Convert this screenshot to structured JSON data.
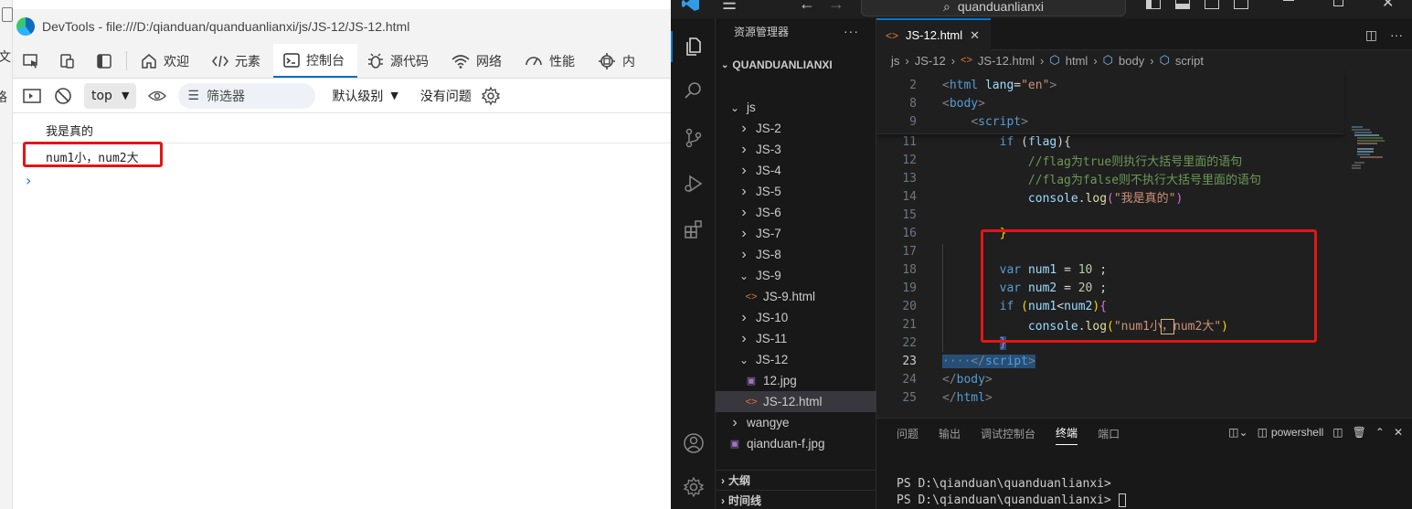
{
  "devtools": {
    "title": "DevTools - file:///D:/qianduan/quanduanlianxi/js/JS-12/JS-12.html",
    "tabs": [
      {
        "label": "欢迎",
        "icon": "home-icon"
      },
      {
        "label": "元素",
        "icon": "code-tag-icon"
      },
      {
        "label": "控制台",
        "icon": "console-icon"
      },
      {
        "label": "源代码",
        "icon": "bug-icon"
      },
      {
        "label": "网络",
        "icon": "wifi-icon"
      },
      {
        "label": "性能",
        "icon": "gauge-icon"
      },
      {
        "label": "内",
        "icon": "gear-chip-icon"
      }
    ],
    "active_tab": "控制台",
    "console_toolbar": {
      "context": "top",
      "filter_placeholder": "筛选器",
      "levels": "默认级别",
      "issues": "没有问题"
    },
    "console_lines": [
      "我是真的",
      "num1小，num2大"
    ],
    "edge_left_chars": [
      "文",
      "格"
    ],
    "accent_color": "#0f6cbd",
    "highlight_color": "#e51414"
  },
  "vscode": {
    "search": "quanduanlianxi",
    "explorer_title": "资源管理器",
    "workspace": "QUANDUANLIANXI",
    "tree": [
      {
        "label": "js",
        "type": "folder",
        "expanded": true,
        "depth": 1
      },
      {
        "label": "JS-2",
        "type": "folder",
        "expanded": false,
        "depth": 2
      },
      {
        "label": "JS-3",
        "type": "folder",
        "expanded": false,
        "depth": 2
      },
      {
        "label": "JS-4",
        "type": "folder",
        "expanded": false,
        "depth": 2
      },
      {
        "label": "JS-5",
        "type": "folder",
        "expanded": false,
        "depth": 2
      },
      {
        "label": "JS-6",
        "type": "folder",
        "expanded": false,
        "depth": 2
      },
      {
        "label": "JS-7",
        "type": "folder",
        "expanded": false,
        "depth": 2
      },
      {
        "label": "JS-8",
        "type": "folder",
        "expanded": false,
        "depth": 2
      },
      {
        "label": "JS-9",
        "type": "folder",
        "expanded": true,
        "depth": 2
      },
      {
        "label": "JS-9.html",
        "type": "html",
        "depth": 3
      },
      {
        "label": "JS-10",
        "type": "folder",
        "expanded": false,
        "depth": 2
      },
      {
        "label": "JS-11",
        "type": "folder",
        "expanded": false,
        "depth": 2
      },
      {
        "label": "JS-12",
        "type": "folder",
        "expanded": true,
        "depth": 2
      },
      {
        "label": "12.jpg",
        "type": "image",
        "depth": 3
      },
      {
        "label": "JS-12.html",
        "type": "html",
        "depth": 3,
        "selected": true
      },
      {
        "label": "wangye",
        "type": "folder",
        "expanded": false,
        "depth": 1
      },
      {
        "label": "qianduan-f.jpg",
        "type": "image",
        "depth": 1
      }
    ],
    "outline_label": "大纲",
    "timeline_label": "时间线",
    "editor_tab": "JS-12.html",
    "breadcrumb": [
      "js",
      "JS-12",
      "JS-12.html",
      "html",
      "body",
      "script"
    ],
    "sticky_lines": [
      {
        "n": "2",
        "html": "<span class='tg'>&lt;</span><span class='tn'>html</span> <span class='at'>lang</span><span class='pl'>=</span><span class='st'>\"en\"</span><span class='tg'>&gt;</span>"
      },
      {
        "n": "8",
        "html": "<span class='tg'>&lt;</span><span class='tn'>body</span><span class='tg'>&gt;</span>"
      },
      {
        "n": "9",
        "html": "    <span class='tg'>&lt;</span><span class='tn'>script</span><span class='tg'>&gt;</span>"
      }
    ],
    "code_lines": [
      {
        "n": "11",
        "html": "        <span class='kw'>if</span> <span class='pl'>(</span><span class='vr'>flag</span><span class='pl'>){</span>"
      },
      {
        "n": "12",
        "html": "            <span class='cm'>//flag为true则执行大括号里面的语句</span>"
      },
      {
        "n": "13",
        "html": "            <span class='cm'>//flag为false则不执行大括号里面的语句</span>"
      },
      {
        "n": "14",
        "html": "            <span class='vr'>console</span><span class='pl'>.</span><span class='fn'>log</span><span class='br2'>(</span><span class='st'>\"我是真的\"</span><span class='br2'>)</span>"
      },
      {
        "n": "15",
        "html": ""
      },
      {
        "n": "16",
        "html": "        <span class='br'>}</span>"
      },
      {
        "n": "17",
        "html": ""
      },
      {
        "n": "18",
        "html": "        <span class='kw'>var</span> <span class='vr'>num1</span> <span class='pl'>=</span> <span class='nm'>10</span> <span class='pl'>;</span>"
      },
      {
        "n": "19",
        "html": "        <span class='kw'>var</span> <span class='vr'>num2</span> <span class='pl'>=</span> <span class='nm'>20</span> <span class='pl'>;</span>"
      },
      {
        "n": "20",
        "html": "        <span class='kw'>if</span> <span class='br'>(</span><span class='vr'>num1</span><span class='pl'>&lt;</span><span class='vr'>num2</span><span class='br'>)</span><span class='br2'>{</span>"
      },
      {
        "n": "21",
        "html": "            <span class='vr'>console</span><span class='pl'>.</span><span class='fn'>log</span><span class='br'>(</span><span class='st'>\"num1小<span style='outline:1px solid #d7ba7d'>，</span>num2大\"</span><span class='br'>)</span>"
      },
      {
        "n": "22",
        "html": "        <span class='br2' style='background:#264f78'>}</span>"
      },
      {
        "n": "23",
        "html": "<span style='background:#264f78'><span class='tg'>····&lt;/</span><span class='tn'>script</span><span class='tg'>&gt;</span></span>",
        "current": true
      },
      {
        "n": "24",
        "html": "<span class='tg'>&lt;/</span><span class='tn'>body</span><span class='tg'>&gt;</span>"
      },
      {
        "n": "25",
        "html": "<span class='tg'>&lt;/</span><span class='tn'>html</span><span class='tg'>&gt;</span>"
      }
    ],
    "panel_tabs": [
      "问题",
      "输出",
      "调试控制台",
      "终端",
      "端口"
    ],
    "active_panel_tab": "终端",
    "shell": "powershell",
    "terminal_lines": [
      "PS D:\\qianduan\\quanduanlianxi>",
      "PS D:\\qianduan\\quanduanlianxi> "
    ],
    "accent_color": "#0078d4"
  }
}
